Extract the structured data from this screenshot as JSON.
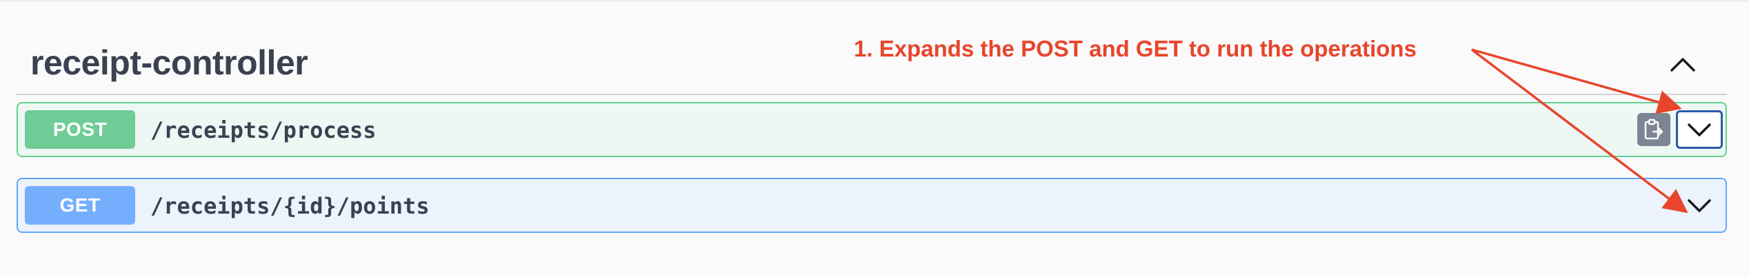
{
  "controller": {
    "title": "receipt-controller"
  },
  "operations": [
    {
      "method": "POST",
      "path": "/receipts/process"
    },
    {
      "method": "GET",
      "path": "/receipts/{id}/points"
    }
  ],
  "annotation": {
    "text": "1. Expands the POST and GET to run the operations"
  },
  "icons": {
    "collapse": "chevron-up-icon",
    "expand": "chevron-down-icon",
    "copy": "clipboard-copy-icon"
  },
  "colors": {
    "post_bg": "#edf7f3",
    "post_border": "#62d091",
    "post_method": "#6fcc96",
    "get_bg": "#ecf3fd",
    "get_border": "#63a4ff",
    "get_method": "#75aefc",
    "annotation": "#e8452c"
  }
}
